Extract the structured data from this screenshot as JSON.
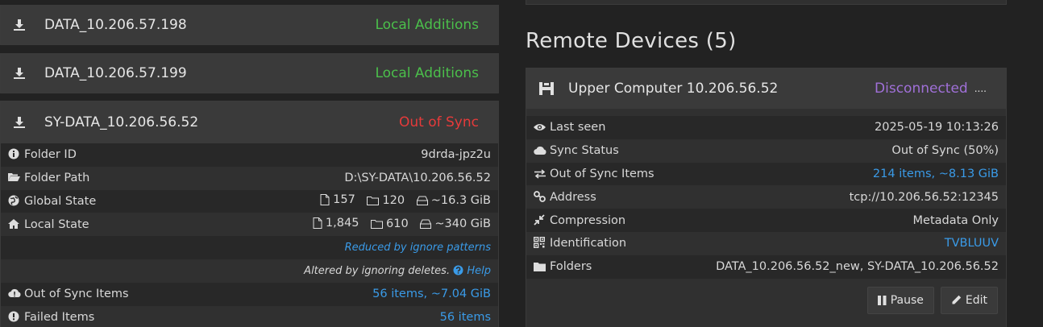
{
  "folders": [
    {
      "name": "DATA_10.206.57.198",
      "status": "Local Additions"
    },
    {
      "name": "DATA_10.206.57.199",
      "status": "Local Additions"
    },
    {
      "name": "SY-DATA_10.206.56.52",
      "status": "Out of Sync"
    }
  ],
  "folder_details": {
    "folder_id": {
      "label": "Folder ID",
      "value": "9drda-jpz2u"
    },
    "folder_path": {
      "label": "Folder Path",
      "value": "D:\\SY-DATA\\10.206.56.52"
    },
    "global_state": {
      "label": "Global State",
      "files": "157",
      "dirs": "120",
      "size": "~16.3 GiB"
    },
    "local_state": {
      "label": "Local State",
      "files": "1,845",
      "dirs": "610",
      "size": "~340 GiB"
    },
    "reduced_note": "Reduced by ignore patterns",
    "altered_note": "Altered by ignoring deletes.",
    "help_label": "Help",
    "out_of_sync": {
      "label": "Out of Sync Items",
      "value": "56 items, ~7.04 GiB"
    },
    "failed": {
      "label": "Failed Items",
      "value": "56 items"
    }
  },
  "remote": {
    "heading": "Remote Devices (5)",
    "device_name": "Upper Computer 10.206.56.52",
    "device_status": "Disconnected",
    "device_status_extra": "....",
    "rows": [
      {
        "icon": "eye-icon",
        "label": "Last seen",
        "value": "2025-05-19 10:13:26"
      },
      {
        "icon": "cloud-icon",
        "label": "Sync Status",
        "value": "Out of Sync (50%)"
      },
      {
        "icon": "exchange-icon",
        "label": "Out of Sync Items",
        "value": "214 items, ~8.13 GiB"
      },
      {
        "icon": "link-icon",
        "label": "Address",
        "value": "tcp://10.206.56.52:12345"
      },
      {
        "icon": "compress-icon",
        "label": "Compression",
        "value": "Metadata Only"
      },
      {
        "icon": "qrcode-icon",
        "label": "Identification",
        "value": "TVBLUUV"
      },
      {
        "icon": "folder-icon",
        "label": "Folders",
        "value": "DATA_10.206.56.52_new, SY-DATA_10.206.56.52"
      }
    ],
    "pause_label": "Pause",
    "edit_label": "Edit"
  },
  "colors": {
    "green": "#4bbf4b",
    "red": "#e63a3a",
    "purple": "#a070d8",
    "link": "#3a9be8"
  }
}
